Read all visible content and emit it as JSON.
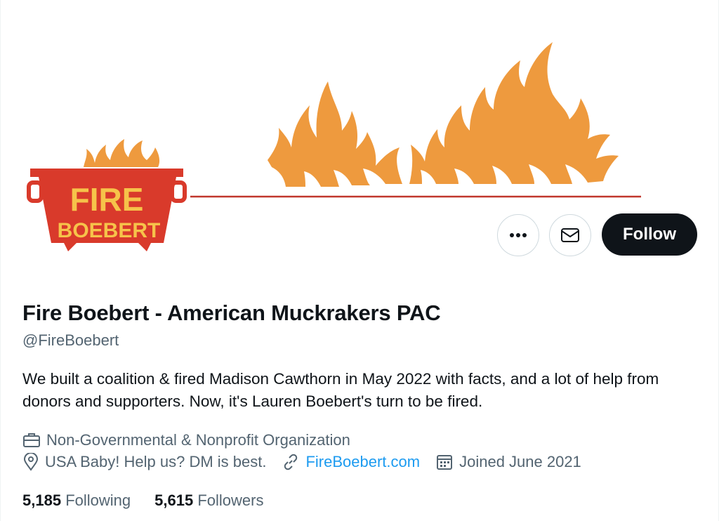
{
  "colors": {
    "flame": "#ee9a3e",
    "avatar_red": "#d93a2b",
    "avatar_text": "#f6c34a",
    "rule_line": "#c0362c",
    "follow_bg": "#0f1419",
    "link": "#1d9bf0",
    "muted": "#536471"
  },
  "avatar": {
    "line1": "FIRE",
    "line2": "BOEBERT"
  },
  "actions": {
    "more_icon": "more-horizontal-icon",
    "message_icon": "envelope-icon",
    "follow_label": "Follow"
  },
  "profile": {
    "display_name": "Fire Boebert - American Muckrakers PAC",
    "handle": "@FireBoebert",
    "bio": "We built a coalition & fired Madison Cawthorn in May 2022 with facts, and a lot of help from donors and supporters. Now, it's Lauren Boebert's turn to be fired.",
    "category": "Non-Governmental & Nonprofit Organization",
    "location": "USA Baby! Help us? DM is best.",
    "website": "FireBoebert.com",
    "joined": "Joined June 2021"
  },
  "stats": {
    "following_count": "5,185",
    "following_label": "Following",
    "followers_count": "5,615",
    "followers_label": "Followers"
  }
}
